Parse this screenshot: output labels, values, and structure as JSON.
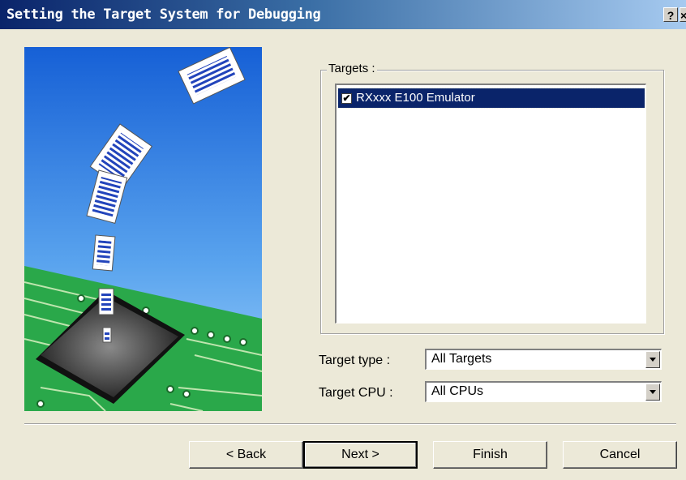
{
  "window": {
    "title": "Setting the Target System for Debugging",
    "help_label": "?",
    "close_label": "×"
  },
  "targets": {
    "group_label": "Targets :",
    "items": [
      {
        "label": "RXxxx E100 Emulator",
        "checked": true,
        "selected": true,
        "check_mark": "✔"
      }
    ]
  },
  "target_type": {
    "label": "Target type :",
    "value": "All Targets"
  },
  "target_cpu": {
    "label": "Target CPU :",
    "value": "All CPUs"
  },
  "buttons": {
    "back": "< Back",
    "next": "Next >",
    "finish": "Finish",
    "cancel": "Cancel"
  },
  "colors": {
    "title_start": "#0a246a",
    "title_end": "#a6caf0",
    "selection": "#0a246a",
    "dialog_bg": "#ece9d8",
    "sky_top": "#1e6fd9",
    "board_green": "#2aa84a"
  }
}
